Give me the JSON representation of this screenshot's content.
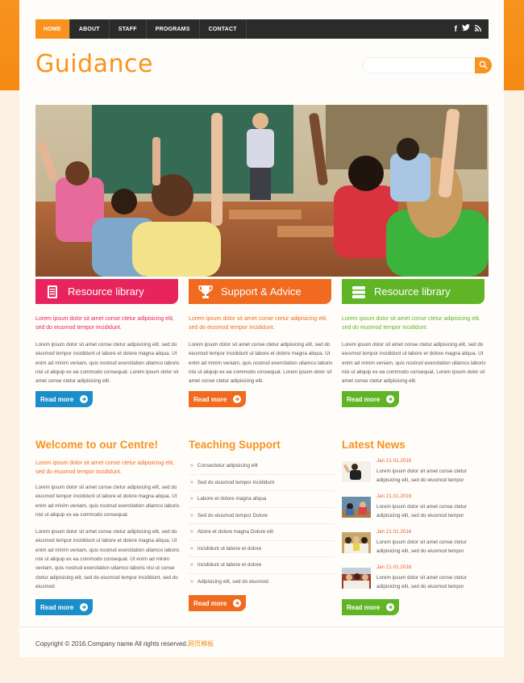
{
  "nav": {
    "items": [
      "HOME",
      "ABOUT",
      "STAFF",
      "PROGRAMS",
      "CONTACT"
    ],
    "active_index": 0,
    "social": [
      "f",
      "t",
      "rss"
    ]
  },
  "header": {
    "logo": "Guidance",
    "search_placeholder": ""
  },
  "features": [
    {
      "title": "Resource library",
      "icon": "book-icon",
      "color": "#e8245c",
      "lead": "Lorem ipsum dolor sit amet conse ctetur adipisicing elit, sed do eiusmod tempor incididunt.",
      "body": "Lorem ipsum dolor sit amet conse ctetur adipisicing elit, sed do eiusmod tempor incididunt ut labore et dolore magna aliqua. Ut enim ad minim veniam, quis nostrud exercitation ullamco laboris nisi ut aliquip ex ea commodo consequat. Lorem ipsum dolor sit amet conse ctetur adipisicing elit.",
      "button": "Read more",
      "button_color": "#1b8ec9"
    },
    {
      "title": "Support & Advice",
      "icon": "trophy-icon",
      "color": "#f06a20",
      "lead": "Lorem ipsum dolor sit amet conse ctetur adipisicing elit, sed do eiusmod tempor incididunt.",
      "body": "Lorem ipsum dolor sit amet conse ctetur adipisicing elit, sed do eiusmod tempor incididunt ut labore et dolore magna aliqua. Ut enim ad minim veniam, quis nostrud exercitation ullamco laboris nisi ut aliquip ex ea commodo consequat. Lorem ipsum dolor sit amet conse ctetur adipisicing elit.",
      "button": "Read more",
      "button_color": "#f06a20"
    },
    {
      "title": "Resource library",
      "icon": "stack-icon",
      "color": "#5fb526",
      "lead": "Lorem ipsum dolor sit amet conse ctetur adipisicing elit, sed do eiusmod tempor incididunt.",
      "body": "Lorem ipsum dolor sit amet conse ctetur adipisicing elit, sed do eiusmod tempor incididunt ut labore et dolore magna aliqua. Ut enim ad minim veniam, quis nostrud exercitation ullamco laboris nisi ut aliquip ex ea commodo consequat. Lorem ipsum dolor sit amet conse ctetur adipisicing elit.",
      "button": "Read more",
      "button_color": "#5fb526"
    }
  ],
  "welcome": {
    "title": "Welcome to our Centre!",
    "lead": "Lorem ipsum dolor sit amet conse ctetur adipisicing elit, sed do eiusmod tempor incididunt.",
    "body1": "Lorem ipsum dolor sit amet conse ctetur adipisicing elit, sed do eiusmod tempor incididunt ut labore et dolore magna aliqua. Ut enim ad minim veniam, quis nostrud exercitation ullamco laboris nisi ut aliquip ex ea commodo consequat.",
    "body2": "Lorem ipsum dolor sit amet conse ctetur adipisicing elit, sed do eiusmod tempor incididunt ut labore et dolore magna aliqua. Ut enim ad minim veniam, quis nostrud exercitation ullamco laboris nisi ut aliquip ex ea commodo consequat. Ut enim ad minim veniam, quis nostrud exercitation ullamco laboris nisi ut conse ctetur adipisicing elit, sed do eiusmod tempor incididunt, sed do eiusmod",
    "button": "Read more"
  },
  "teaching": {
    "title": "Teaching Support",
    "items": [
      "Consectetur adipisicing elit",
      "Sed do eiusmod tempor incididunt",
      "Labore et dolore magna aliqua",
      "Sed do eiusmod tempor Dolore",
      "Abore et dolore magna Dolore elit",
      "Incididunt ut labore et dolore",
      "Incididunt ut labore et dolore",
      "Adipisicing elit, sed do eiusmod"
    ],
    "button": "Read more"
  },
  "news": {
    "title": "Latest News",
    "items": [
      {
        "date": "Jan 21.01.2016",
        "text": "Lorem ipsum dolor sit amet conse ctetur adipisicing elit, sed do eiusmod tempor"
      },
      {
        "date": "Jan 21.01.2016",
        "text": "Lorem ipsum dolor sit amet conse ctetur adipisicing elit, sed do eiusmod tempor"
      },
      {
        "date": "Jan 21.01.2016",
        "text": "Lorem ipsum dolor sit amet conse ctetur adipisicing elit, sed do eiusmod tempor"
      },
      {
        "date": "Jan 21.01.2016",
        "text": "Lorem ipsum dolor sit amet conse ctetur adipisicing elit, sed do eiusmod tempor"
      }
    ],
    "button": "Read more"
  },
  "footer": {
    "copyright": "Copyright © 2016.Company name All rights reserved.",
    "cn_link": "网页模板"
  },
  "colors": {
    "orange": "#f7931e",
    "pink": "#e8245c",
    "green": "#5fb526",
    "blue": "#1b8ec9",
    "dark_nav": "#2b2b2b"
  }
}
